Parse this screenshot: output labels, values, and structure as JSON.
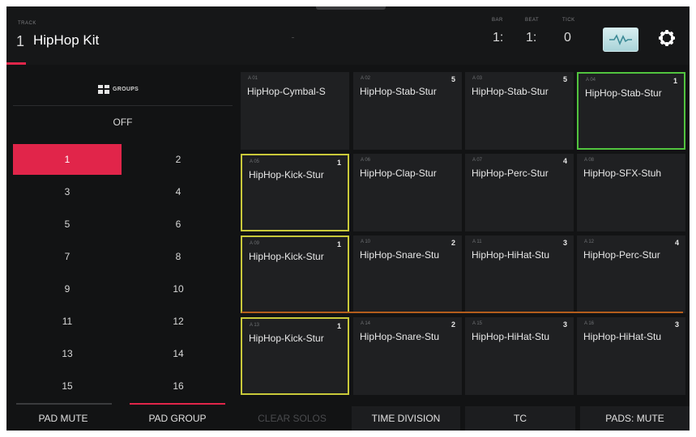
{
  "header": {
    "track_caption": "TRACK",
    "track_number": "1",
    "track_name": "HipHop Kit",
    "bar_caption": "BAR",
    "beat_caption": "BEAT",
    "tick_caption": "TICK",
    "bar_value": "1:",
    "beat_value": "1:",
    "tick_value": "0",
    "wave_icon": "waveform-icon",
    "gear_icon": "gear-icon"
  },
  "groups": {
    "label": "GROUPS",
    "off_label": "OFF",
    "items": [
      "1",
      "2",
      "3",
      "4",
      "5",
      "6",
      "7",
      "8",
      "9",
      "10",
      "11",
      "12",
      "13",
      "14",
      "15",
      "16"
    ],
    "selected": "1"
  },
  "pads": [
    {
      "name": "HipHop-Kick-Stur",
      "number": "1",
      "slot": "A 13"
    },
    {
      "name": "HipHop-Snare-Stu",
      "number": "2",
      "slot": "A 14"
    },
    {
      "name": "HipHop-HiHat-Stu",
      "number": "3",
      "slot": "A 15"
    },
    {
      "name": "HipHop-HiHat-Stu",
      "number": "3",
      "slot": "A 16"
    },
    {
      "name": "HipHop-Kick-Stur",
      "number": "1",
      "slot": "A 09"
    },
    {
      "name": "HipHop-Snare-Stu",
      "number": "2",
      "slot": "A 10"
    },
    {
      "name": "HipHop-HiHat-Stu",
      "number": "3",
      "slot": "A 11"
    },
    {
      "name": "HipHop-Perc-Stur",
      "number": "4",
      "slot": "A 12"
    },
    {
      "name": "HipHop-Kick-Stur",
      "number": "1",
      "slot": "A 05"
    },
    {
      "name": "HipHop-Clap-Stur",
      "number": "",
      "slot": "A 06"
    },
    {
      "name": "HipHop-Perc-Stur",
      "number": "4",
      "slot": "A 07"
    },
    {
      "name": "HipHop-SFX-Stuh",
      "number": "",
      "slot": "A 08"
    },
    {
      "name": "HipHop-Cymbal-S",
      "number": "",
      "slot": "A 01"
    },
    {
      "name": "HipHop-Stab-Stur",
      "number": "5",
      "slot": "A 02"
    },
    {
      "name": "HipHop-Stab-Stur",
      "number": "5",
      "slot": "A 03"
    },
    {
      "name": "HipHop-Stab-Stur",
      "number": "1",
      "slot": "A 04"
    }
  ],
  "bottom": {
    "pad_mute": "PAD MUTE",
    "pad_group": "PAD GROUP",
    "clear_solos": "CLEAR SOLOS",
    "time_division": "TIME DIVISION",
    "tc": "TC",
    "pads_mute": "PADS: MUTE"
  },
  "colors": {
    "accent": "#e1254a",
    "pad_yellow": "#c9c93a",
    "pad_green": "#52c43f",
    "row_divider": "#b45d1c"
  }
}
